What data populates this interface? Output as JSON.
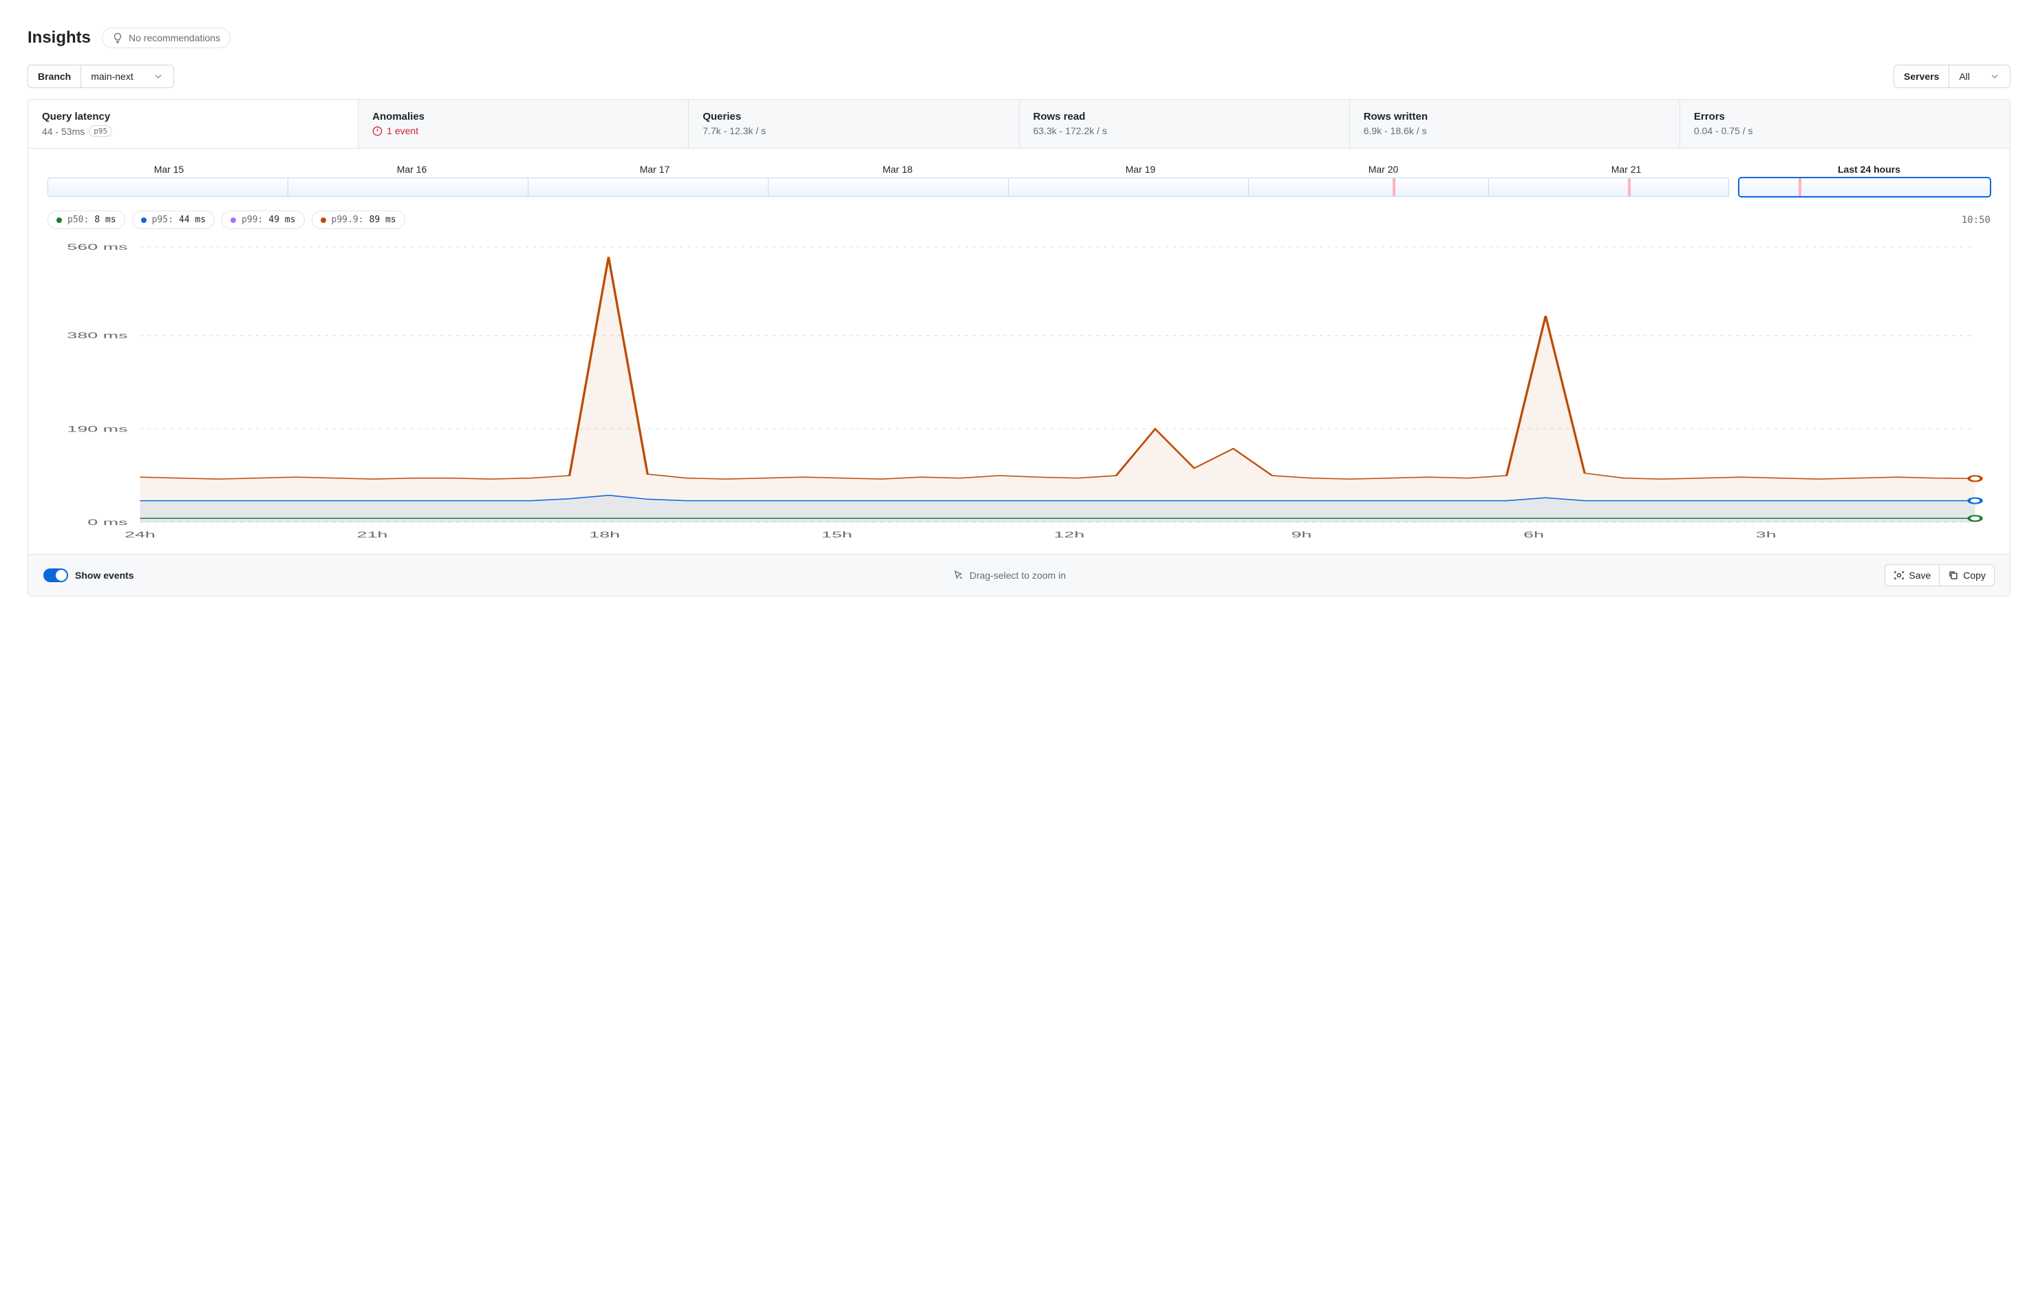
{
  "header": {
    "title": "Insights",
    "recommendation_text": "No recommendations"
  },
  "toolbar": {
    "branch_label": "Branch",
    "branch_value": "main-next",
    "servers_label": "Servers",
    "servers_value": "All"
  },
  "tabs": [
    {
      "title": "Query latency",
      "sub": "44 - 53ms",
      "badge": "p95",
      "active": true
    },
    {
      "title": "Anomalies",
      "sub": "1 event",
      "alert": true
    },
    {
      "title": "Queries",
      "sub": "7.7k - 12.3k / s"
    },
    {
      "title": "Rows read",
      "sub": "63.3k - 172.2k / s"
    },
    {
      "title": "Rows written",
      "sub": "6.9k - 18.6k / s"
    },
    {
      "title": "Errors",
      "sub": "0.04 - 0.75 / s"
    }
  ],
  "dates": [
    "Mar 15",
    "Mar 16",
    "Mar 17",
    "Mar 18",
    "Mar 19",
    "Mar 20",
    "Mar 21",
    "Last 24 hours"
  ],
  "legend": {
    "items": [
      {
        "color": "#1a7f37",
        "label": "p50:",
        "value": "8 ms"
      },
      {
        "color": "#0969da",
        "label": "p95:",
        "value": "44 ms"
      },
      {
        "color": "#a475f9",
        "label": "p99:",
        "value": "49 ms"
      },
      {
        "color": "#bc4c00",
        "label": "p99.9:",
        "value": "89 ms"
      }
    ],
    "timestamp": "10:50"
  },
  "chart_data": {
    "type": "line",
    "xlabel": "",
    "ylabel": "",
    "ylim": [
      0,
      560
    ],
    "y_ticks": [
      "0 ms",
      "190 ms",
      "380 ms",
      "560 ms"
    ],
    "x_ticks": [
      "24h",
      "21h",
      "18h",
      "15h",
      "12h",
      "9h",
      "6h",
      "3h"
    ],
    "x": [
      0,
      1,
      2,
      3,
      4,
      5,
      6,
      7,
      8,
      9,
      10,
      11,
      12,
      13,
      14,
      15,
      16,
      17,
      18,
      19,
      20,
      21,
      22,
      23,
      24,
      25,
      26,
      27,
      28,
      29,
      30,
      31,
      32,
      33,
      34,
      35,
      36,
      37,
      38,
      39,
      40,
      41,
      42,
      43,
      44,
      45,
      46,
      47
    ],
    "series": [
      {
        "name": "p50",
        "color": "#1a7f37",
        "values": [
          8,
          8,
          8,
          8,
          8,
          8,
          8,
          8,
          8,
          8,
          8,
          8,
          8,
          8,
          8,
          8,
          8,
          8,
          8,
          8,
          8,
          8,
          8,
          8,
          8,
          8,
          8,
          8,
          8,
          8,
          8,
          8,
          8,
          8,
          8,
          8,
          8,
          8,
          8,
          8,
          8,
          8,
          8,
          8,
          8,
          8,
          8,
          8
        ]
      },
      {
        "name": "p95",
        "color": "#0969da",
        "values": [
          44,
          44,
          44,
          44,
          44,
          44,
          44,
          44,
          44,
          44,
          44,
          48,
          55,
          47,
          44,
          44,
          44,
          44,
          44,
          44,
          44,
          44,
          44,
          44,
          44,
          44,
          44,
          44,
          44,
          44,
          44,
          44,
          44,
          44,
          44,
          44,
          50,
          44,
          44,
          44,
          44,
          44,
          44,
          44,
          44,
          44,
          44,
          44
        ]
      },
      {
        "name": "p99",
        "color": "#a475f9",
        "values": [
          49,
          49,
          49,
          49,
          49,
          49,
          49,
          49,
          49,
          49,
          49,
          50,
          56,
          50,
          49,
          49,
          49,
          49,
          49,
          49,
          49,
          49,
          49,
          49,
          49,
          49,
          49,
          49,
          49,
          49,
          49,
          49,
          49,
          49,
          49,
          49,
          52,
          49,
          49,
          49,
          49,
          49,
          49,
          49,
          49,
          49,
          49,
          49
        ]
      },
      {
        "name": "p99.9",
        "color": "#bc4c00",
        "values": [
          92,
          90,
          88,
          90,
          92,
          90,
          88,
          90,
          90,
          88,
          90,
          95,
          540,
          98,
          90,
          88,
          90,
          92,
          90,
          88,
          92,
          90,
          95,
          92,
          90,
          95,
          190,
          110,
          150,
          95,
          90,
          88,
          90,
          92,
          90,
          95,
          420,
          100,
          90,
          88,
          90,
          92,
          90,
          88,
          90,
          92,
          90,
          89
        ]
      }
    ]
  },
  "footer": {
    "toggle_label": "Show events",
    "hint": "Drag-select to zoom in",
    "save_label": "Save",
    "copy_label": "Copy"
  }
}
